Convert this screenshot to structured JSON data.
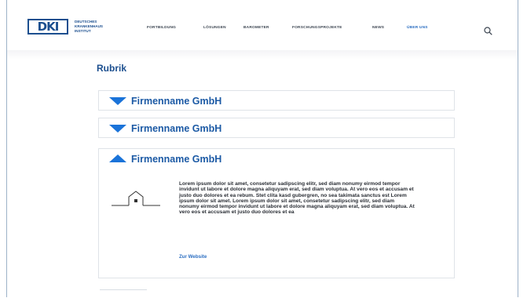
{
  "logo": {
    "mark": "DKI",
    "lines": [
      "DEUTSCHES",
      "KRANKENHAUS",
      "INSTITUT"
    ]
  },
  "nav": {
    "items": [
      "FORTBILDUNG",
      "LÖSUNGEN",
      "BAROMETER",
      "FORSCHUNGSPROJEKTE",
      "NEWS",
      "ÜBER UNS"
    ]
  },
  "icons": {
    "search": "search-icon",
    "collapsed": "triangle-down-icon",
    "expanded": "triangle-up-icon",
    "company": "house-icon"
  },
  "colors": {
    "accent": "#1a73d9",
    "heading": "#1c4f8f",
    "link": "#2c6fc2"
  },
  "main": {
    "rubrik": "Rubrik",
    "accordion": [
      {
        "title": "Firmenname GmbH",
        "expanded": false
      },
      {
        "title": "Firmenname GmbH",
        "expanded": false
      },
      {
        "title": "Firmenname GmbH",
        "expanded": true,
        "text": "Lorem ipsum dolor sit amet, consetetur sadipscing elitr, sed diam nonumy eirmod tempor invidunt ut labore et dolore magna aliquyam erat, sed diam voluptua. At vero eos et accusam et justo duo dolores et ea rebum. Stet clita kasd gubergren, no sea takimata sanctus est Lorem ipsum dolor sit amet. Lorem ipsum dolor sit amet, consetetur sadipscing elitr, sed diam nonumy eirmod tempor invidunt ut labore et dolore magna aliquyam erat, sed diam voluptua. At vero eos et accusam et justo duo dolores et ea",
        "link": "Zur Website"
      }
    ]
  }
}
